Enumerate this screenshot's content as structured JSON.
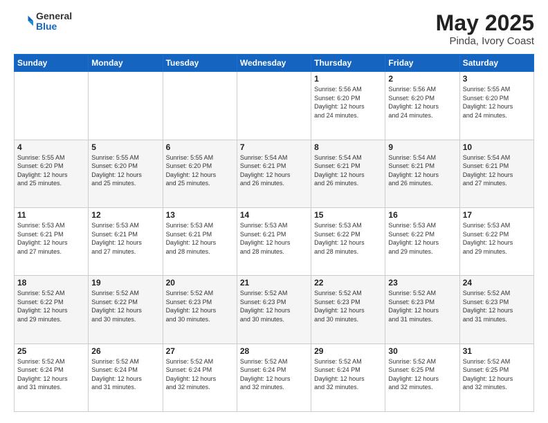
{
  "header": {
    "logo_general": "General",
    "logo_blue": "Blue",
    "month": "May 2025",
    "location": "Pinda, Ivory Coast"
  },
  "weekdays": [
    "Sunday",
    "Monday",
    "Tuesday",
    "Wednesday",
    "Thursday",
    "Friday",
    "Saturday"
  ],
  "weeks": [
    [
      {
        "day": "",
        "info": ""
      },
      {
        "day": "",
        "info": ""
      },
      {
        "day": "",
        "info": ""
      },
      {
        "day": "",
        "info": ""
      },
      {
        "day": "1",
        "info": "Sunrise: 5:56 AM\nSunset: 6:20 PM\nDaylight: 12 hours\nand 24 minutes."
      },
      {
        "day": "2",
        "info": "Sunrise: 5:56 AM\nSunset: 6:20 PM\nDaylight: 12 hours\nand 24 minutes."
      },
      {
        "day": "3",
        "info": "Sunrise: 5:55 AM\nSunset: 6:20 PM\nDaylight: 12 hours\nand 24 minutes."
      }
    ],
    [
      {
        "day": "4",
        "info": "Sunrise: 5:55 AM\nSunset: 6:20 PM\nDaylight: 12 hours\nand 25 minutes."
      },
      {
        "day": "5",
        "info": "Sunrise: 5:55 AM\nSunset: 6:20 PM\nDaylight: 12 hours\nand 25 minutes."
      },
      {
        "day": "6",
        "info": "Sunrise: 5:55 AM\nSunset: 6:20 PM\nDaylight: 12 hours\nand 25 minutes."
      },
      {
        "day": "7",
        "info": "Sunrise: 5:54 AM\nSunset: 6:21 PM\nDaylight: 12 hours\nand 26 minutes."
      },
      {
        "day": "8",
        "info": "Sunrise: 5:54 AM\nSunset: 6:21 PM\nDaylight: 12 hours\nand 26 minutes."
      },
      {
        "day": "9",
        "info": "Sunrise: 5:54 AM\nSunset: 6:21 PM\nDaylight: 12 hours\nand 26 minutes."
      },
      {
        "day": "10",
        "info": "Sunrise: 5:54 AM\nSunset: 6:21 PM\nDaylight: 12 hours\nand 27 minutes."
      }
    ],
    [
      {
        "day": "11",
        "info": "Sunrise: 5:53 AM\nSunset: 6:21 PM\nDaylight: 12 hours\nand 27 minutes."
      },
      {
        "day": "12",
        "info": "Sunrise: 5:53 AM\nSunset: 6:21 PM\nDaylight: 12 hours\nand 27 minutes."
      },
      {
        "day": "13",
        "info": "Sunrise: 5:53 AM\nSunset: 6:21 PM\nDaylight: 12 hours\nand 28 minutes."
      },
      {
        "day": "14",
        "info": "Sunrise: 5:53 AM\nSunset: 6:21 PM\nDaylight: 12 hours\nand 28 minutes."
      },
      {
        "day": "15",
        "info": "Sunrise: 5:53 AM\nSunset: 6:22 PM\nDaylight: 12 hours\nand 28 minutes."
      },
      {
        "day": "16",
        "info": "Sunrise: 5:53 AM\nSunset: 6:22 PM\nDaylight: 12 hours\nand 29 minutes."
      },
      {
        "day": "17",
        "info": "Sunrise: 5:53 AM\nSunset: 6:22 PM\nDaylight: 12 hours\nand 29 minutes."
      }
    ],
    [
      {
        "day": "18",
        "info": "Sunrise: 5:52 AM\nSunset: 6:22 PM\nDaylight: 12 hours\nand 29 minutes."
      },
      {
        "day": "19",
        "info": "Sunrise: 5:52 AM\nSunset: 6:22 PM\nDaylight: 12 hours\nand 30 minutes."
      },
      {
        "day": "20",
        "info": "Sunrise: 5:52 AM\nSunset: 6:23 PM\nDaylight: 12 hours\nand 30 minutes."
      },
      {
        "day": "21",
        "info": "Sunrise: 5:52 AM\nSunset: 6:23 PM\nDaylight: 12 hours\nand 30 minutes."
      },
      {
        "day": "22",
        "info": "Sunrise: 5:52 AM\nSunset: 6:23 PM\nDaylight: 12 hours\nand 30 minutes."
      },
      {
        "day": "23",
        "info": "Sunrise: 5:52 AM\nSunset: 6:23 PM\nDaylight: 12 hours\nand 31 minutes."
      },
      {
        "day": "24",
        "info": "Sunrise: 5:52 AM\nSunset: 6:23 PM\nDaylight: 12 hours\nand 31 minutes."
      }
    ],
    [
      {
        "day": "25",
        "info": "Sunrise: 5:52 AM\nSunset: 6:24 PM\nDaylight: 12 hours\nand 31 minutes."
      },
      {
        "day": "26",
        "info": "Sunrise: 5:52 AM\nSunset: 6:24 PM\nDaylight: 12 hours\nand 31 minutes."
      },
      {
        "day": "27",
        "info": "Sunrise: 5:52 AM\nSunset: 6:24 PM\nDaylight: 12 hours\nand 32 minutes."
      },
      {
        "day": "28",
        "info": "Sunrise: 5:52 AM\nSunset: 6:24 PM\nDaylight: 12 hours\nand 32 minutes."
      },
      {
        "day": "29",
        "info": "Sunrise: 5:52 AM\nSunset: 6:24 PM\nDaylight: 12 hours\nand 32 minutes."
      },
      {
        "day": "30",
        "info": "Sunrise: 5:52 AM\nSunset: 6:25 PM\nDaylight: 12 hours\nand 32 minutes."
      },
      {
        "day": "31",
        "info": "Sunrise: 5:52 AM\nSunset: 6:25 PM\nDaylight: 12 hours\nand 32 minutes."
      }
    ]
  ]
}
